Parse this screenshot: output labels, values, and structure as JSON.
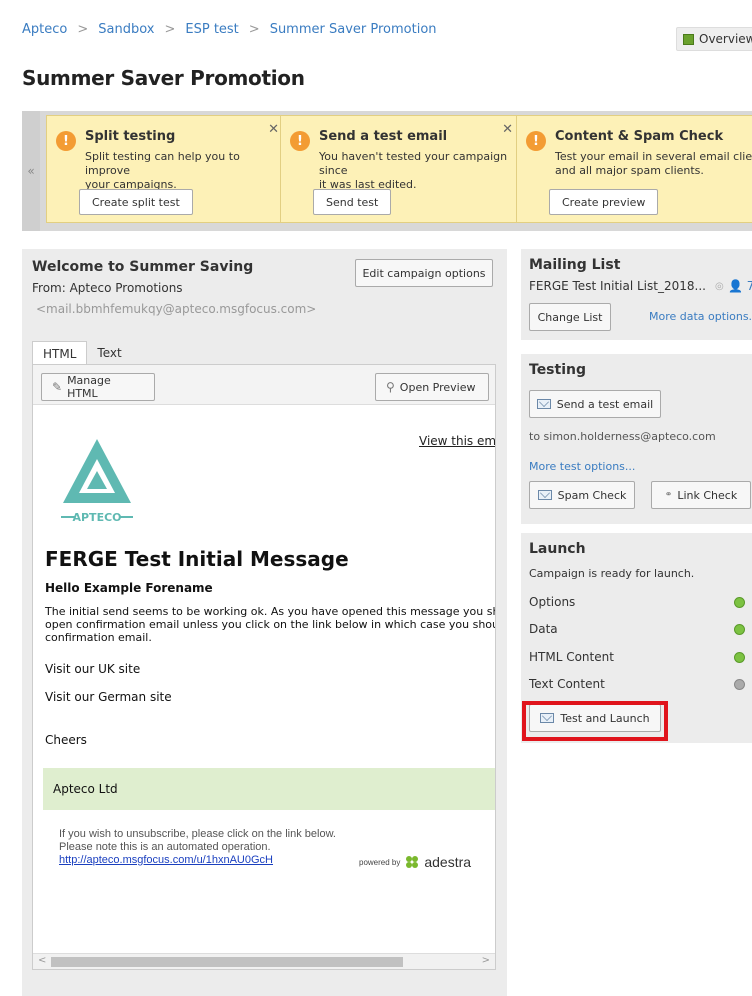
{
  "breadcrumb": [
    "Apteco",
    "Sandbox",
    "ESP test",
    "Summer Saver Promotion"
  ],
  "overview_label": "Overview",
  "page_title": "Summer Saver Promotion",
  "notices": [
    {
      "title": "Split testing",
      "body": "Split testing can help you to improve\nyour campaigns.",
      "button": "Create split test"
    },
    {
      "title": "Send a test email",
      "body": "You haven't tested your campaign since\nit was last edited.",
      "button": "Send test"
    },
    {
      "title": "Content & Spam Check",
      "body": "Test your email in several email clie\nand all major spam clients.",
      "button": "Create preview"
    }
  ],
  "campaign": {
    "title": "Welcome to Summer Saving",
    "from": "From: Apteco Promotions",
    "from_email": "<mail.bbmhfemukqy@apteco.msgfocus.com>",
    "edit_button": "Edit campaign options"
  },
  "tabs": [
    "HTML",
    "Text"
  ],
  "toolbar": {
    "manage_html": "Manage HTML",
    "open_preview": "Open Preview"
  },
  "email": {
    "view_link": "View this emai",
    "logo_text": "APTECO",
    "heading": "FERGE Test Initial Message",
    "greeting": "Hello Example Forename",
    "paragraph": "The initial send seems to be working ok. As you have opened this message you shou\nopen confirmation email unless you click on the link below in which case you shoulc\nconfirmation email.",
    "link_uk": "Visit our UK site",
    "link_de": "Visit our German site",
    "signoff": "Cheers",
    "footer_company": "Apteco Ltd",
    "unsubscribe_text": "If you wish to unsubscribe, please click on the link below.\nPlease note this is an automated operation.",
    "unsubscribe_link": "http://apteco.msgfocus.com/u/1hxnAU0GcH",
    "powered_by": "powered by",
    "adestra": "adestra"
  },
  "mailing_list": {
    "title": "Mailing List",
    "list_name": "FERGE Test Initial List_2018...",
    "count": "7",
    "change_button": "Change List",
    "more_link": "More data options..."
  },
  "testing": {
    "title": "Testing",
    "send_button": "Send a test email",
    "to_line": "to simon.holderness@apteco.com",
    "more_link": "More test options...",
    "spam_button": "Spam Check",
    "link_button": "Link Check"
  },
  "launch": {
    "title": "Launch",
    "status": "Campaign is ready for launch.",
    "rows": [
      {
        "label": "Options",
        "state": "ok"
      },
      {
        "label": "Data",
        "state": "ok"
      },
      {
        "label": "HTML Content",
        "state": "ok"
      },
      {
        "label": "Text Content",
        "state": "na"
      }
    ],
    "button": "Test and Launch"
  },
  "colors": {
    "accent": "#3a7cc1",
    "notice_bg": "#fdf1b7",
    "highlight": "#e0141c",
    "ok": "#7cc242"
  }
}
